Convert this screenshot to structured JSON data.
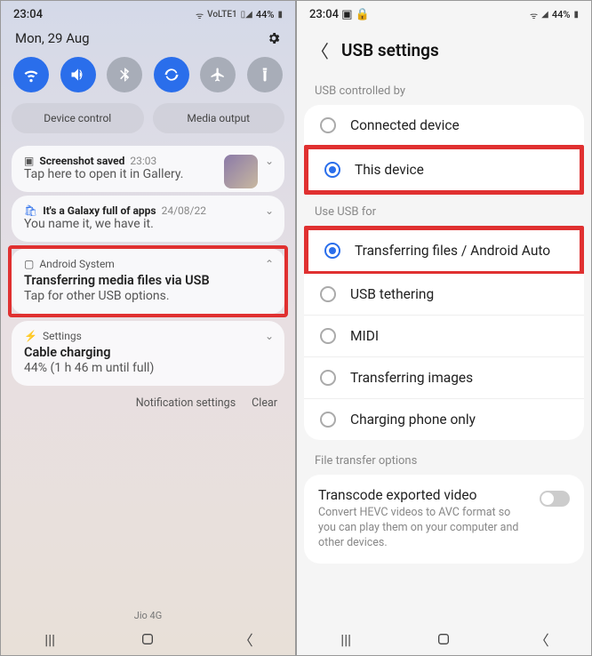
{
  "left": {
    "status": {
      "time": "23:04",
      "battery": "44%",
      "net": "VoLTE1"
    },
    "date": "Mon, 29 Aug",
    "qs2": {
      "device_control": "Device control",
      "media_output": "Media output"
    },
    "notif": [
      {
        "app": "Screenshot saved",
        "ts": "23:03",
        "body": "Tap here to open it in Gallery.",
        "chev": "⌄"
      },
      {
        "app": "It's a Galaxy full of apps",
        "ts": "24/08/22",
        "body": "You name it, we have it.",
        "chev": "⌄"
      },
      {
        "src": "Android System",
        "title": "Transferring media files via USB",
        "body": "Tap for other USB options.",
        "chev": "⌃"
      },
      {
        "src": "Settings",
        "title": "Cable charging",
        "body": "44% (1 h 46 m until full)",
        "chev": "⌄"
      }
    ],
    "actions": {
      "settings": "Notification settings",
      "clear": "Clear"
    },
    "carrier": "Jio 4G"
  },
  "right": {
    "status": {
      "time": "23:04",
      "battery": "44%"
    },
    "title": "USB settings",
    "sec1": {
      "label": "USB controlled by",
      "items": [
        {
          "label": "Connected device",
          "checked": false
        },
        {
          "label": "This device",
          "checked": true
        }
      ]
    },
    "sec2": {
      "label": "Use USB for",
      "items": [
        {
          "label": "Transferring files / Android Auto",
          "checked": true
        },
        {
          "label": "USB tethering",
          "checked": false
        },
        {
          "label": "MIDI",
          "checked": false
        },
        {
          "label": "Transferring images",
          "checked": false
        },
        {
          "label": "Charging phone only",
          "checked": false
        }
      ]
    },
    "sec3": {
      "label": "File transfer options",
      "toggle": {
        "title": "Transcode exported video",
        "desc": "Convert HEVC videos to AVC format so you can play them on your computer and other devices."
      }
    }
  }
}
